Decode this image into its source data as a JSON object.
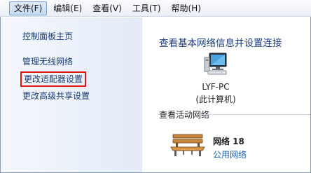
{
  "menubar": {
    "items": [
      {
        "label": "文件(F)"
      },
      {
        "label": "编辑(E)"
      },
      {
        "label": "查看(V)"
      },
      {
        "label": "工具(T)"
      },
      {
        "label": "帮助(H)"
      }
    ]
  },
  "nav": {
    "links": [
      {
        "label": "控制面板主页"
      },
      {
        "label": "管理无线网络"
      },
      {
        "label": "更改适配器设置"
      },
      {
        "label": "更改高级共享设置"
      }
    ]
  },
  "content": {
    "title": "查看基本网络信息并设置连接",
    "computer": {
      "name": "LYF-PC",
      "subtitle": "(此计算机)"
    },
    "active_networks_header": "查看活动网络",
    "network": {
      "name": "网络  18",
      "type": "公用网络"
    }
  },
  "colors": {
    "link": "#1a3c78",
    "highlight_border": "#e01414",
    "network_type": "#1a5fa8"
  },
  "icons": [
    "computer-icon",
    "bench-icon"
  ]
}
